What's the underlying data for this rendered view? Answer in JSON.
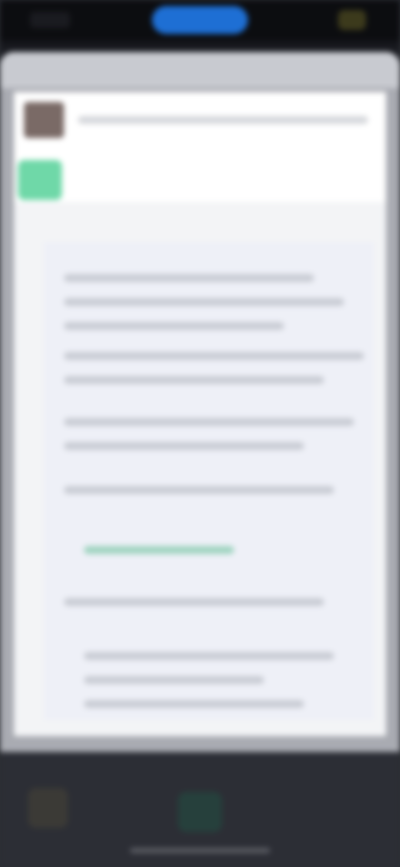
{
  "status_bar": {
    "pill_color": "#1e6fd4"
  },
  "sheet": {
    "title": ""
  },
  "page": {
    "badge_text": "",
    "accent_color": "#6fd8a8"
  },
  "icons": {
    "avatar": "avatar-icon",
    "badge": "app-badge-icon",
    "bottom_left": "app-icon",
    "bottom_center": "app-icon"
  }
}
